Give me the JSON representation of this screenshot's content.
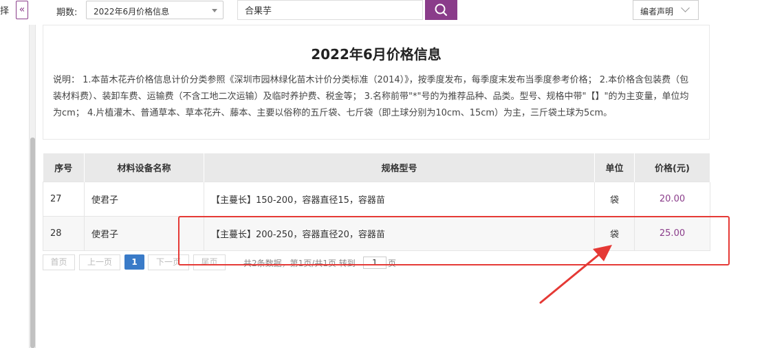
{
  "left": {
    "stub_text": "择",
    "collapse_glyph": "«"
  },
  "toolbar": {
    "period_label": "期数:",
    "period_value": "2022年6月价格信息",
    "search_value": "合果芋",
    "editor_label": "编者声明"
  },
  "info": {
    "title": "2022年6月价格信息",
    "text": "说明：  1.本苗木花卉价格信息计价分类参照《深圳市园林绿化苗木计价分类标准（2014）》，按季度发布，每季度末发布当季度参考价格；  2.本价格含包装费（包装材料费）、装卸车费、运输费（不含工地二次运输）及临时养护费、税金等；  3.名称前带\"*\"号的为推荐品种、品类。型号、规格中带\"【】\"的为主变量，单位均为cm；  4.片植灌木、普通草本、草本花卉、藤本、主要以俗称的五斤袋、七斤袋（即土球分别为10cm、15cm）为主，三斤袋土球为5cm。"
  },
  "table": {
    "headers": [
      "序号",
      "材料设备名称",
      "规格型号",
      "单位",
      "价格(元)"
    ],
    "rows": [
      {
        "no": "27",
        "name": "使君子",
        "spec": "【主蔓长】150-200，容器直径15，容器苗",
        "unit": "袋",
        "price": "20.00"
      },
      {
        "no": "28",
        "name": "使君子",
        "spec": "【主蔓长】200-250，容器直径20，容器苗",
        "unit": "袋",
        "price": "25.00"
      }
    ]
  },
  "pager": {
    "first": "首页",
    "prev": "上一页",
    "current": "1",
    "next": "下一页",
    "last": "尾页",
    "info": "共2条数据，第1页/共1页  转到",
    "goto_value": "1",
    "page_suffix": "页"
  },
  "colors": {
    "accent": "#8a3c8a",
    "pager_active": "#3a7bc8",
    "annotation": "#e53935"
  }
}
